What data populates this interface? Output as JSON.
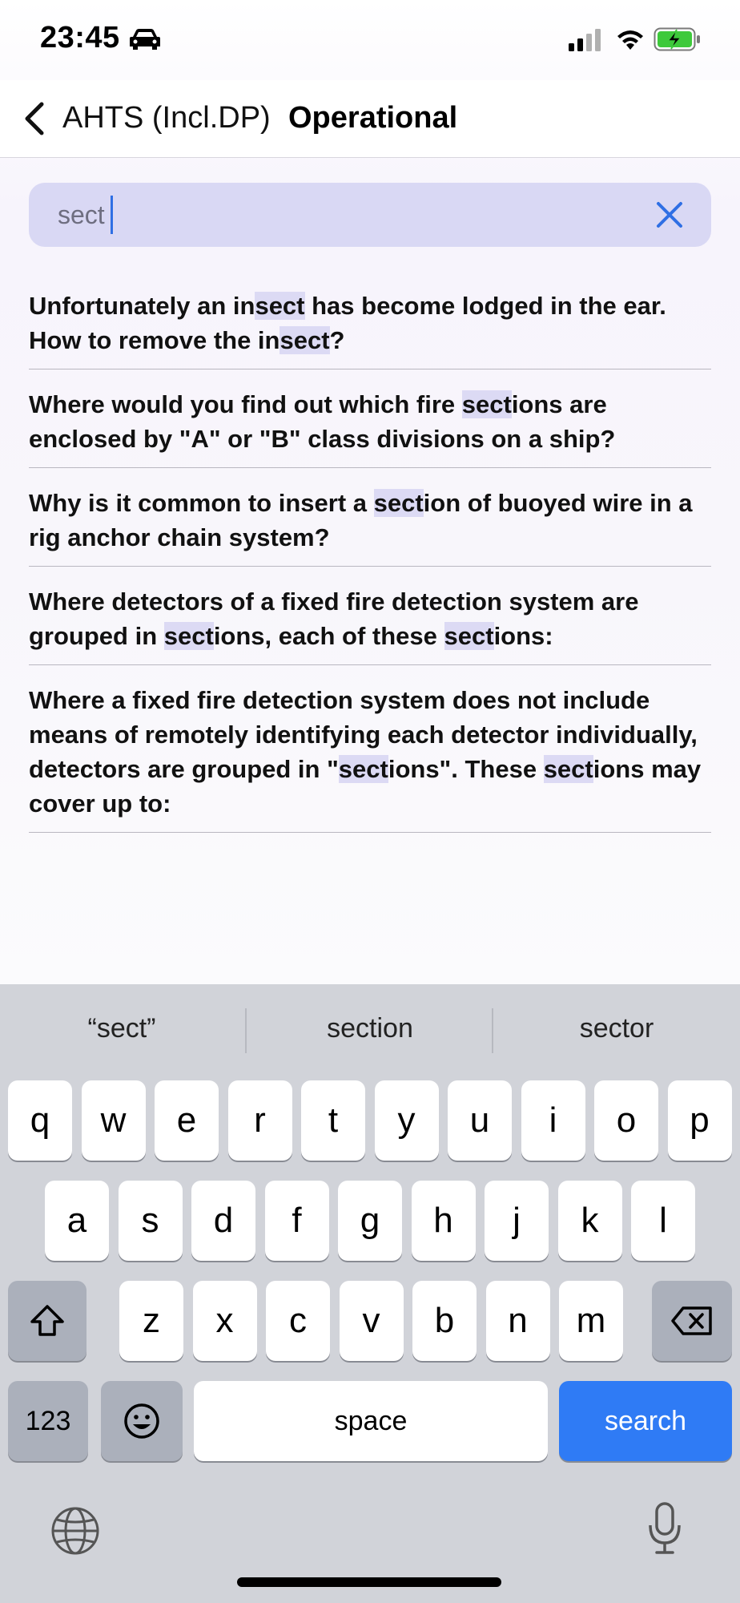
{
  "status_bar": {
    "time": "23:45",
    "icons": [
      "car-icon",
      "signal-icon",
      "wifi-icon",
      "battery-charging-icon"
    ]
  },
  "nav": {
    "back_label": "AHTS (Incl.DP)",
    "title": "Operational",
    "back_icon": "chevron-left-icon"
  },
  "search": {
    "value": "sect",
    "clear_icon": "close-icon",
    "highlight_color": "#dcdaf4",
    "box_color": "#d9d8f4"
  },
  "results": [
    {
      "parts": [
        "Unfortunately an in",
        "sect",
        " has become lodged in the ear. How to remove the in",
        "sect",
        "?"
      ]
    },
    {
      "parts": [
        "Where would you find out which fire ",
        "sect",
        "ions are enclosed by \"A\" or \"B\" class divisions on a ship?"
      ]
    },
    {
      "parts": [
        "Why is it common to insert a ",
        "sect",
        "ion of buoyed wire in a rig anchor chain system?"
      ]
    },
    {
      "parts": [
        "Where detectors of a fixed fire detection system are grouped in ",
        "sect",
        "ions, each of these ",
        "sect",
        "ions:"
      ]
    },
    {
      "parts": [
        "Where a fixed fire detection system does not include means of remotely identifying each detector individually, detectors are grouped in \"",
        "sect",
        "ions\". These ",
        "sect",
        "ions may cover up to:"
      ]
    }
  ],
  "keyboard": {
    "suggestions": [
      "“sect”",
      "section",
      "sector"
    ],
    "row1": [
      "q",
      "w",
      "e",
      "r",
      "t",
      "y",
      "u",
      "i",
      "o",
      "p"
    ],
    "row2": [
      "a",
      "s",
      "d",
      "f",
      "g",
      "h",
      "j",
      "k",
      "l"
    ],
    "row3": [
      "z",
      "x",
      "c",
      "v",
      "b",
      "n",
      "m"
    ],
    "numbers_label": "123",
    "space_label": "space",
    "search_label": "search",
    "icons": [
      "shift-icon",
      "backspace-icon",
      "emoji-icon",
      "globe-icon",
      "microphone-icon"
    ],
    "accent_color": "#2f7bf5"
  }
}
